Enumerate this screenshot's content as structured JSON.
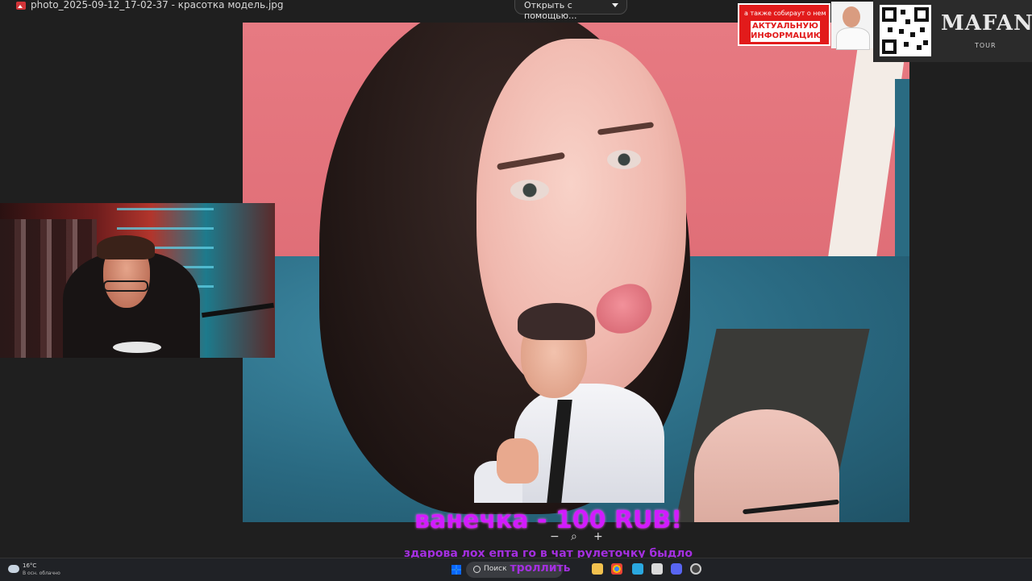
{
  "viewer": {
    "file_title": "photo_2025-09-12_17-02-37 - красотка модель.jpg",
    "open_with_label": "Открыть с помощью...",
    "zoom_out": "−",
    "zoom_fit": "⌕",
    "zoom_in": "+"
  },
  "overlays": {
    "promo_small": "а также собираут о нем",
    "promo_big": "АКТУАЛЬНУЮ ИНФОРМАЦИЮ",
    "tour_brand": "MAFANYA",
    "tour_sub": "TOUR",
    "donation_title": "ванечка - 100 RUB!",
    "donation_message_line1": "здарова лох епта го в чат рулеточку быдло",
    "donation_message_line2": "троллить"
  },
  "taskbar": {
    "weather_temp": "16°C",
    "weather_desc": "В осн. облачно",
    "search_label": "Поиск",
    "app_icons": [
      "chrome-icon",
      "explorer-icon",
      "vscode-icon",
      "edge-icon",
      "discord-icon",
      "telegram-icon",
      "obs-icon"
    ]
  },
  "colors": {
    "donation": "#d21bff",
    "message": "#a42fe0",
    "promo_red": "#e21b1b"
  }
}
